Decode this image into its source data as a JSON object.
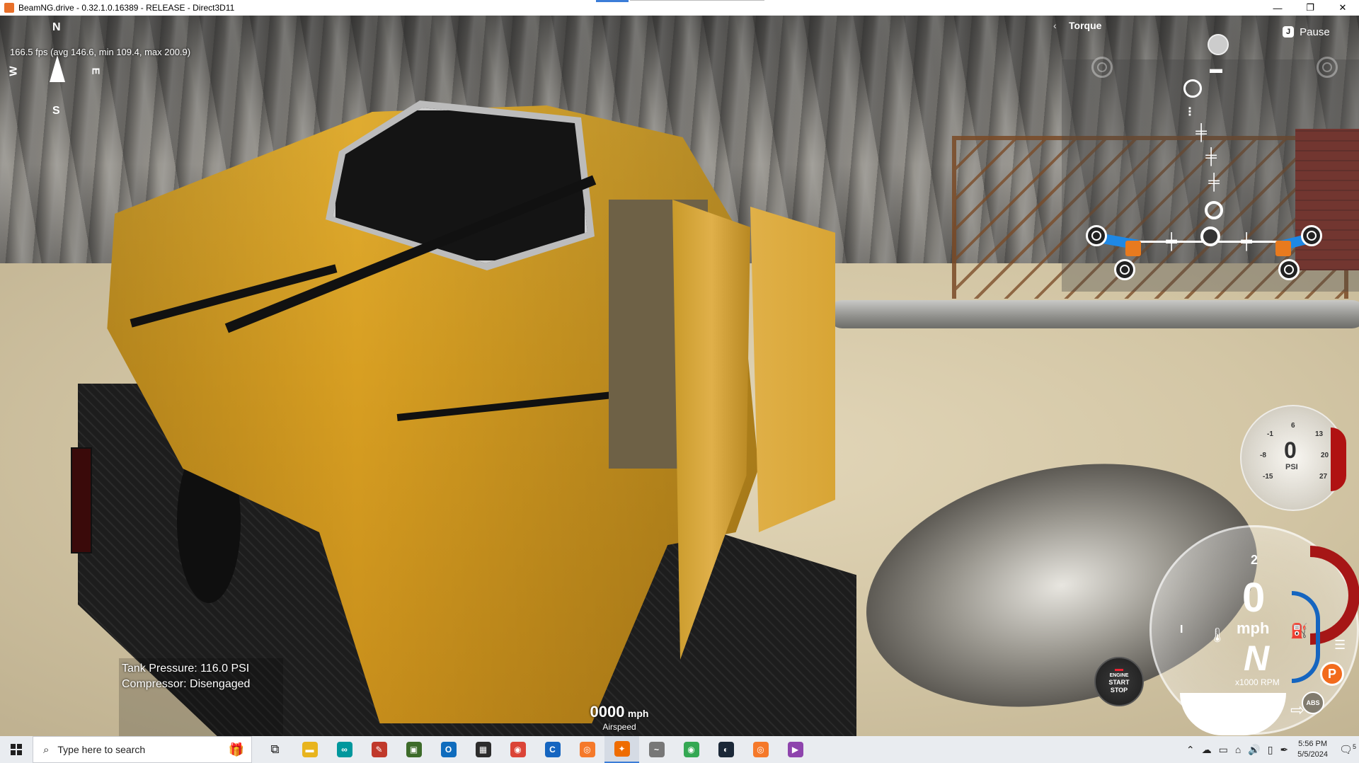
{
  "window": {
    "title": "BeamNG.drive - 0.32.1.0.16389 - RELEASE - Direct3D11",
    "minimize": "—",
    "maximize": "❐",
    "close": "✕"
  },
  "hud": {
    "compass": {
      "n": "N",
      "s": "S",
      "e": "E",
      "w": "W"
    },
    "fps": "166.5 fps (avg 146.6, min 109.4, max 200.9)",
    "torque_title": "Torque",
    "torque_back": "‹",
    "pause": {
      "key": "J",
      "label": "Pause"
    },
    "tank_pressure": "Tank Pressure: 116.0 PSI",
    "compressor": "Compressor: Disengaged",
    "airspeed": {
      "value": "0000",
      "unit": "mph",
      "label": "Airspeed"
    },
    "pressure_gauge": {
      "value": "0",
      "unit": "PSI",
      "ticks": [
        "-1",
        "6",
        "13",
        "-8",
        "20",
        "-15",
        "27"
      ]
    },
    "speedometer": {
      "gear_top": "2",
      "speed": "0",
      "unit": "mph",
      "gear": "N",
      "rpm_label": "x1000 RPM",
      "left_tick": "I",
      "park": "P",
      "abs": "ABS"
    },
    "engine_button": {
      "line1": "ENGINE",
      "line2": "START",
      "line3": "STOP"
    }
  },
  "taskbar": {
    "search_placeholder": "Type here to search",
    "clock_time": "5:56 PM",
    "clock_date": "5/5/2024",
    "notification_count": "5",
    "apps": [
      {
        "name": "task-view",
        "glyph": "⧉",
        "color": ""
      },
      {
        "name": "file-explorer",
        "glyph": "▬",
        "color": "#e8b41e"
      },
      {
        "name": "arduino",
        "glyph": "∞",
        "color": "#00979d"
      },
      {
        "name": "app-pen",
        "glyph": "✎",
        "color": "#c0392b"
      },
      {
        "name": "minecraft",
        "glyph": "▣",
        "color": "#3d6b2a"
      },
      {
        "name": "outlook",
        "glyph": "O",
        "color": "#0f6cbd"
      },
      {
        "name": "creeper",
        "glyph": "▦",
        "color": "#2c2c2c"
      },
      {
        "name": "chrome",
        "glyph": "◉",
        "color": "#db4437"
      },
      {
        "name": "app-c",
        "glyph": "C",
        "color": "#1565c0"
      },
      {
        "name": "blender",
        "glyph": "◎",
        "color": "#f5792a"
      },
      {
        "name": "beamng",
        "glyph": "✦",
        "color": "#ef6c00"
      },
      {
        "name": "app-scribble",
        "glyph": "~",
        "color": "#777"
      },
      {
        "name": "chrome-profile",
        "glyph": "◉",
        "color": "#34a853"
      },
      {
        "name": "steam",
        "glyph": "◐",
        "color": "#1b2838"
      },
      {
        "name": "blender-2",
        "glyph": "◎",
        "color": "#f5792a"
      },
      {
        "name": "visual-studio",
        "glyph": "▶",
        "color": "#8e44ad"
      }
    ]
  }
}
